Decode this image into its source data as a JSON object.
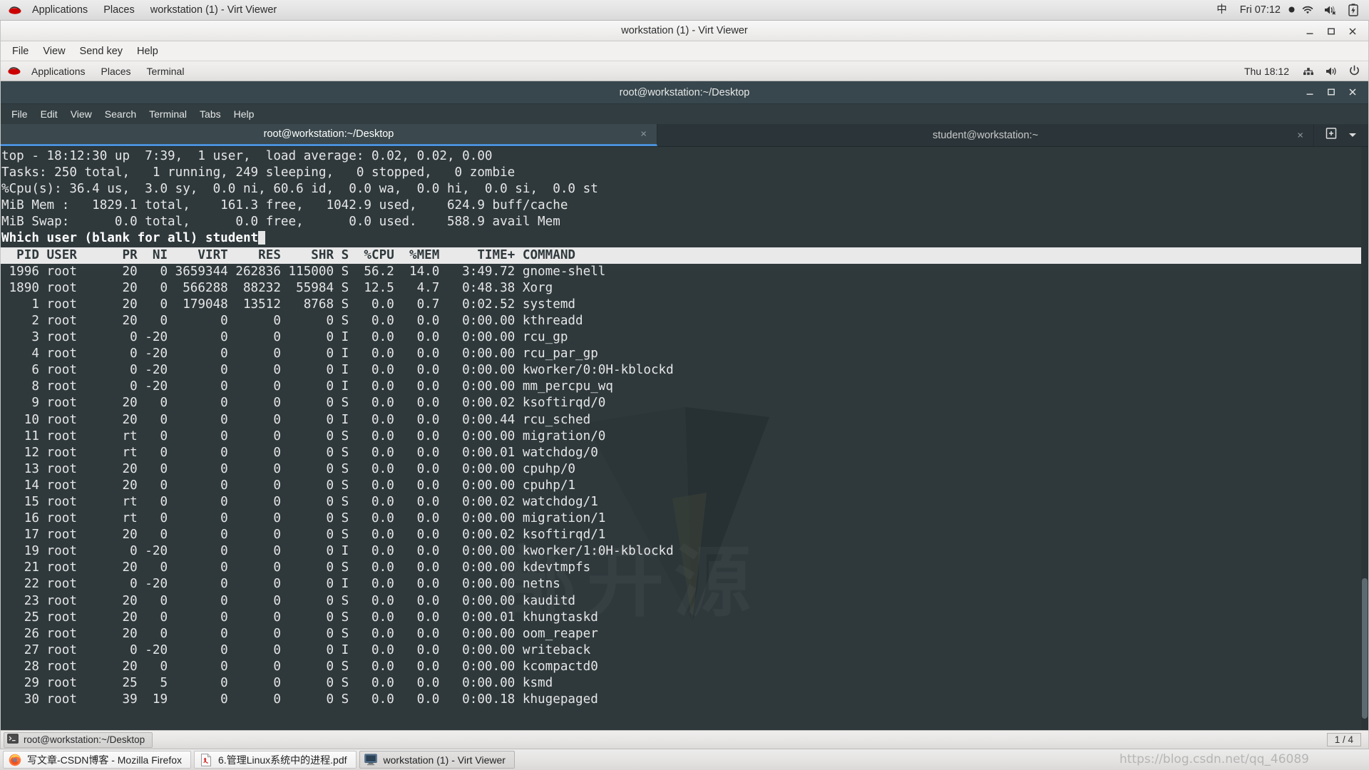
{
  "host_panel": {
    "logo": "redhat-logo",
    "items": [
      {
        "label": "Applications"
      },
      {
        "label": "Places"
      },
      {
        "label": "workstation (1) - Virt Viewer"
      }
    ],
    "ime": "中",
    "clock": "Fri 07:12",
    "tray": [
      "wifi-icon",
      "volume-muted-icon",
      "battery-charging-icon"
    ]
  },
  "virt_viewer": {
    "title": "workstation (1) - Virt Viewer",
    "menu": [
      "File",
      "View",
      "Send key",
      "Help"
    ],
    "window_buttons": [
      "minimize",
      "maximize",
      "close"
    ]
  },
  "guest_panel": {
    "items": [
      {
        "label": "Applications"
      },
      {
        "label": "Places"
      },
      {
        "label": "Terminal"
      }
    ],
    "clock": "Thu 18:12",
    "tray": [
      "network-icon",
      "volume-icon",
      "power-icon"
    ]
  },
  "terminal": {
    "title": "root@workstation:~/Desktop",
    "menu": [
      "File",
      "Edit",
      "View",
      "Search",
      "Terminal",
      "Tabs",
      "Help"
    ],
    "tabs": [
      {
        "label": "root@workstation:~/Desktop",
        "active": true,
        "close": "×"
      },
      {
        "label": "student@workstation:~",
        "active": false,
        "close": "×"
      }
    ],
    "tab_extra": [
      "new-tab-icon",
      "tab-list-chevron-icon"
    ],
    "window_buttons": [
      "minimize",
      "maximize",
      "close"
    ]
  },
  "top_output": {
    "summary": [
      "top - 18:12:30 up  7:39,  1 user,  load average: 0.02, 0.02, 0.00",
      "Tasks: 250 total,   1 running, 249 sleeping,   0 stopped,   0 zombie",
      "%Cpu(s): 36.4 us,  3.0 sy,  0.0 ni, 60.6 id,  0.0 wa,  0.0 hi,  0.0 si,  0.0 st",
      "MiB Mem :   1829.1 total,    161.3 free,   1042.9 used,    624.9 buff/cache",
      "MiB Swap:      0.0 total,      0.0 free,      0.0 used.    588.9 avail Mem"
    ],
    "prompt": "Which user (blank for all) student",
    "header": "  PID USER      PR  NI    VIRT    RES    SHR S  %CPU  %MEM     TIME+ COMMAND",
    "rows": [
      " 1996 root      20   0 3659344 262836 115000 S  56.2  14.0   3:49.72 gnome-shell",
      " 1890 root      20   0  566288  88232  55984 S  12.5   4.7   0:48.38 Xorg",
      "    1 root      20   0  179048  13512   8768 S   0.0   0.7   0:02.52 systemd",
      "    2 root      20   0       0      0      0 S   0.0   0.0   0:00.00 kthreadd",
      "    3 root       0 -20       0      0      0 I   0.0   0.0   0:00.00 rcu_gp",
      "    4 root       0 -20       0      0      0 I   0.0   0.0   0:00.00 rcu_par_gp",
      "    6 root       0 -20       0      0      0 I   0.0   0.0   0:00.00 kworker/0:0H-kblockd",
      "    8 root       0 -20       0      0      0 I   0.0   0.0   0:00.00 mm_percpu_wq",
      "    9 root      20   0       0      0      0 S   0.0   0.0   0:00.02 ksoftirqd/0",
      "   10 root      20   0       0      0      0 I   0.0   0.0   0:00.44 rcu_sched",
      "   11 root      rt   0       0      0      0 S   0.0   0.0   0:00.00 migration/0",
      "   12 root      rt   0       0      0      0 S   0.0   0.0   0:00.01 watchdog/0",
      "   13 root      20   0       0      0      0 S   0.0   0.0   0:00.00 cpuhp/0",
      "   14 root      20   0       0      0      0 S   0.0   0.0   0:00.00 cpuhp/1",
      "   15 root      rt   0       0      0      0 S   0.0   0.0   0:00.02 watchdog/1",
      "   16 root      rt   0       0      0      0 S   0.0   0.0   0:00.00 migration/1",
      "   17 root      20   0       0      0      0 S   0.0   0.0   0:00.02 ksoftirqd/1",
      "   19 root       0 -20       0      0      0 I   0.0   0.0   0:00.00 kworker/1:0H-kblockd",
      "   21 root      20   0       0      0      0 S   0.0   0.0   0:00.00 kdevtmpfs",
      "   22 root       0 -20       0      0      0 I   0.0   0.0   0:00.00 netns",
      "   23 root      20   0       0      0      0 S   0.0   0.0   0:00.00 kauditd",
      "   25 root      20   0       0      0      0 S   0.0   0.0   0:00.01 khungtaskd",
      "   26 root      20   0       0      0      0 S   0.0   0.0   0:00.00 oom_reaper",
      "   27 root       0 -20       0      0      0 I   0.0   0.0   0:00.00 writeback",
      "   28 root      20   0       0      0      0 S   0.0   0.0   0:00.00 kcompactd0",
      "   29 root      25   5       0      0      0 S   0.0   0.0   0:00.00 ksmd",
      "   30 root      39  19       0      0      0 S   0.0   0.0   0:00.18 khugepaged"
    ]
  },
  "guest_taskbar": {
    "task": {
      "icon": "terminal-icon",
      "label": "root@workstation:~/Desktop"
    },
    "workspace": "1 / 4"
  },
  "host_taskbar": {
    "tasks": [
      {
        "icon": "firefox-icon",
        "label": "写文章-CSDN博客 - Mozilla Firefox",
        "active": false
      },
      {
        "icon": "pdf-icon",
        "label": "6.管理Linux系统中的进程.pdf",
        "active": false
      },
      {
        "icon": "virt-viewer-icon",
        "label": "workstation (1) - Virt Viewer",
        "active": true
      }
    ],
    "watermark": "https://blog.csdn.net/qq_46089"
  },
  "wallpaper": {
    "watermark_text": "部开源"
  },
  "colors": {
    "terminal_bg": "#2f393c",
    "terminal_fg": "#e6e6e6",
    "tab_accent": "#4a90d9",
    "header_bg": "#e9e9e9",
    "redhat_red": "#cc0000"
  }
}
